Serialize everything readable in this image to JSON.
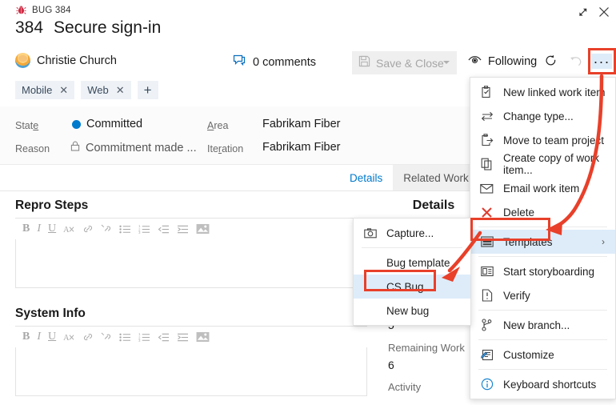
{
  "window": {
    "expand_icon": "expand-icon",
    "close_icon": "close-icon"
  },
  "header": {
    "work_item_type": "BUG 384",
    "type_icon": "bug-icon",
    "id": "384",
    "title": "Secure sign-in",
    "assignee": "Christie Church",
    "avatar_icon": "avatar",
    "comments_icon": "comment-icon",
    "comments": "0 comments",
    "save_close_label": "Save & Close",
    "save_close_icon": "save-icon",
    "following_label": "Following",
    "following_icon": "eye-icon",
    "refresh_icon": "refresh-icon",
    "undo_icon": "undo-icon",
    "more_actions": "···"
  },
  "tags": [
    {
      "label": "Mobile",
      "remove": "✕"
    },
    {
      "label": "Web",
      "remove": "✕"
    }
  ],
  "tag_add": "+",
  "fields": [
    {
      "label": "State",
      "value": "Committed",
      "has_dot": true
    },
    {
      "label": "Reason",
      "value": "Commitment made ...",
      "has_lock": true
    },
    {
      "label": "Area",
      "value": "Fabrikam Fiber"
    },
    {
      "label": "Iteration",
      "value": "Fabrikam Fiber"
    }
  ],
  "tabs": [
    {
      "label": "Details",
      "active": true
    },
    {
      "label": "Related Work item",
      "active": false
    }
  ],
  "sections": [
    {
      "title": "Repro Steps"
    },
    {
      "title": "System Info"
    }
  ],
  "editor_toolbar": [
    "bold-icon",
    "italic-icon",
    "underline-icon",
    "clear-format-icon",
    "link-icon",
    "unlink-icon",
    "bullet-list-icon",
    "numbered-list-icon",
    "outdent-icon",
    "indent-icon",
    "image-icon"
  ],
  "details_panel": {
    "heading": "Details",
    "rows": [
      {
        "value": "5",
        "label": "Remaining Work"
      },
      {
        "value": "6",
        "label": "Activity"
      }
    ]
  },
  "context_menu": {
    "items": [
      {
        "label": "New linked work item",
        "icon": "new-linked-work-item-icon"
      },
      {
        "label": "Change type...",
        "icon": "change-type-icon"
      },
      {
        "label": "Move to team project",
        "icon": "move-to-team-project-icon"
      },
      {
        "label": "Create copy of work item...",
        "icon": "copy-work-item-icon"
      },
      {
        "label": "Email work item",
        "icon": "email-icon"
      },
      {
        "label": "Delete",
        "icon": "delete-icon"
      },
      {
        "label": "Templates",
        "icon": "templates-icon",
        "submenu_chevron": "›",
        "highlighted": true
      },
      {
        "label": "Start storyboarding",
        "icon": "storyboard-icon"
      },
      {
        "label": "Verify",
        "icon": "verify-icon"
      },
      {
        "label": "New branch...",
        "icon": "branch-icon"
      },
      {
        "label": "Customize",
        "icon": "customize-icon"
      },
      {
        "label": "Keyboard shortcuts",
        "icon": "info-icon"
      }
    ]
  },
  "templates_submenu": {
    "items": [
      {
        "label": "Capture...",
        "icon": "camera-icon"
      },
      {
        "label": "Bug template"
      },
      {
        "label": "CS Bug",
        "highlighted": true
      },
      {
        "label": "New bug"
      }
    ]
  },
  "colors": {
    "accent_red": "#c4273c",
    "annotation_red": "#e8402a",
    "highlight_blue": "#deecf9",
    "link_blue": "#007acc",
    "state_dot": "#007acc"
  }
}
